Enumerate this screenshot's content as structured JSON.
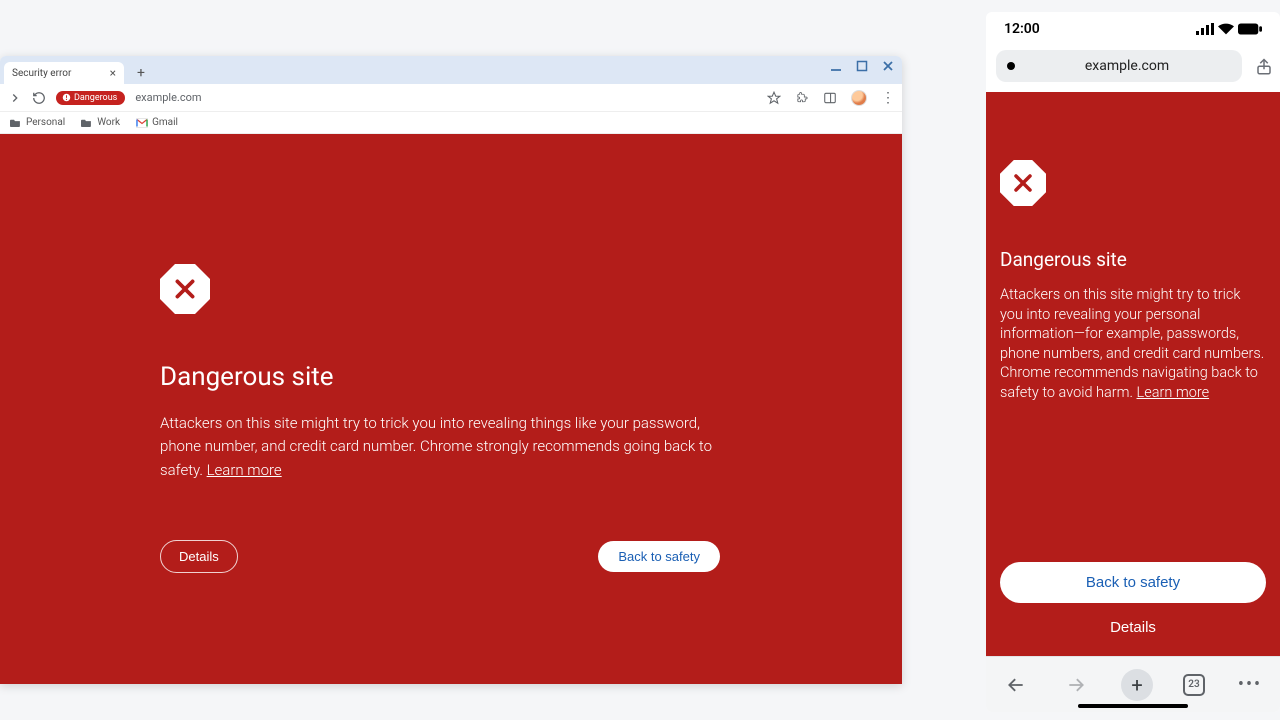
{
  "desktop": {
    "tab_title": "Security error",
    "danger_chip": "Dangerous",
    "url": "example.com",
    "bookmarks": {
      "personal": "Personal",
      "work": "Work",
      "gmail": "Gmail"
    },
    "warning": {
      "title": "Dangerous site",
      "body": "Attackers on this site might try to trick you into revealing things like your password, phone number, and credit card number. Chrome strongly recommends going back to safety. ",
      "learn_more": "Learn more",
      "details": "Details",
      "back": "Back to safety"
    }
  },
  "mobile": {
    "time": "12:00",
    "url": "example.com",
    "tab_count": "23",
    "warning": {
      "title": "Dangerous site",
      "body": "Attackers on this site might try to trick you into revealing your personal information—for example, passwords, phone numbers, and credit card numbers. Chrome recommends navigating back to safety to avoid harm. ",
      "learn_more": "Learn more",
      "back": "Back to safety",
      "details": "Details"
    }
  }
}
